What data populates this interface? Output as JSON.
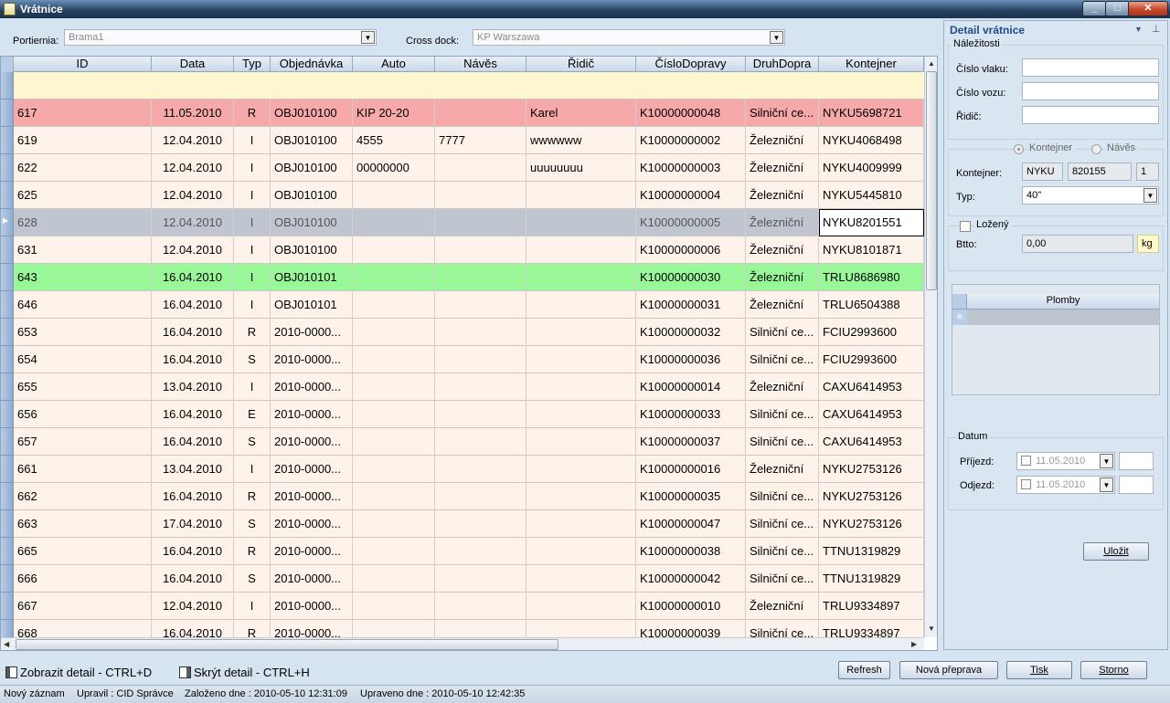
{
  "window": {
    "title": "Vrátnice",
    "minimize": "_",
    "maximize": "□",
    "close": "✕"
  },
  "filters": {
    "portiernia_label": "Portiernia:",
    "portiernia_value": "Brama1",
    "crossdock_label": "Cross dock:",
    "crossdock_value": "KP Warszawa"
  },
  "grid": {
    "columns": [
      "ID",
      "Data",
      "Typ",
      "Objednávka",
      "Auto",
      "Návěs",
      "Řidič",
      "ČísloDopravy",
      "DruhDopra",
      "Kontejner"
    ],
    "rows": [
      {
        "id": "617",
        "data": "11.05.2010",
        "typ": "R",
        "obj": "OBJ010100",
        "auto": "KIP 20-20",
        "naves": "",
        "ridic": "Karel",
        "cislo": "K10000000048",
        "druh": "Silniční ce...",
        "kont": "NYKU5698721",
        "bg": "#f7a9a9"
      },
      {
        "id": "619",
        "data": "12.04.2010",
        "typ": "I",
        "obj": "OBJ010100",
        "auto": "4555",
        "naves": "7777",
        "ridic": "wwwwww",
        "cislo": "K10000000002",
        "druh": "Železniční",
        "kont": "NYKU4068498",
        "bg": "#fdf3ea"
      },
      {
        "id": "622",
        "data": "12.04.2010",
        "typ": "I",
        "obj": "OBJ010100",
        "auto": "00000000",
        "naves": "",
        "ridic": "uuuuuuuu",
        "cislo": "K10000000003",
        "druh": "Železniční",
        "kont": "NYKU4009999",
        "bg": "#fdf3ea"
      },
      {
        "id": "625",
        "data": "12.04.2010",
        "typ": "I",
        "obj": "OBJ010100",
        "auto": "",
        "naves": "",
        "ridic": "",
        "cislo": "K10000000004",
        "druh": "Železniční",
        "kont": "NYKU5445810",
        "bg": "#fdf3ea"
      },
      {
        "id": "628",
        "data": "12.04.2010",
        "typ": "I",
        "obj": "OBJ010100",
        "auto": "",
        "naves": "",
        "ridic": "",
        "cislo": "K10000000005",
        "druh": "Železniční",
        "kont": "NYKU8201551",
        "bg": "#bfc6cf",
        "current": true
      },
      {
        "id": "631",
        "data": "12.04.2010",
        "typ": "I",
        "obj": "OBJ010100",
        "auto": "",
        "naves": "",
        "ridic": "",
        "cislo": "K10000000006",
        "druh": "Železniční",
        "kont": "NYKU8101871",
        "bg": "#fdf3ea"
      },
      {
        "id": "643",
        "data": "16.04.2010",
        "typ": "I",
        "obj": "OBJ010101",
        "auto": "",
        "naves": "",
        "ridic": "",
        "cislo": "K10000000030",
        "druh": "Železniční",
        "kont": "TRLU8686980",
        "bg": "#98f898"
      },
      {
        "id": "646",
        "data": "16.04.2010",
        "typ": "I",
        "obj": "OBJ010101",
        "auto": "",
        "naves": "",
        "ridic": "",
        "cislo": "K10000000031",
        "druh": "Železniční",
        "kont": "TRLU6504388",
        "bg": "#fdf3ea"
      },
      {
        "id": "653",
        "data": "16.04.2010",
        "typ": "R",
        "obj": "2010-0000...",
        "auto": "",
        "naves": "",
        "ridic": "",
        "cislo": "K10000000032",
        "druh": "Silniční ce...",
        "kont": "FCIU2993600",
        "bg": "#fdf3ea"
      },
      {
        "id": "654",
        "data": "16.04.2010",
        "typ": "S",
        "obj": "2010-0000...",
        "auto": "",
        "naves": "",
        "ridic": "",
        "cislo": "K10000000036",
        "druh": "Silniční ce...",
        "kont": "FCIU2993600",
        "bg": "#fdf3ea"
      },
      {
        "id": "655",
        "data": "13.04.2010",
        "typ": "I",
        "obj": "2010-0000...",
        "auto": "",
        "naves": "",
        "ridic": "",
        "cislo": "K10000000014",
        "druh": "Železniční",
        "kont": "CAXU6414953",
        "bg": "#fdf3ea"
      },
      {
        "id": "656",
        "data": "16.04.2010",
        "typ": "E",
        "obj": "2010-0000...",
        "auto": "",
        "naves": "",
        "ridic": "",
        "cislo": "K10000000033",
        "druh": "Silniční ce...",
        "kont": "CAXU6414953",
        "bg": "#fdf3ea"
      },
      {
        "id": "657",
        "data": "16.04.2010",
        "typ": "S",
        "obj": "2010-0000...",
        "auto": "",
        "naves": "",
        "ridic": "",
        "cislo": "K10000000037",
        "druh": "Silniční ce...",
        "kont": "CAXU6414953",
        "bg": "#fdf3ea"
      },
      {
        "id": "661",
        "data": "13.04.2010",
        "typ": "I",
        "obj": "2010-0000...",
        "auto": "",
        "naves": "",
        "ridic": "",
        "cislo": "K10000000016",
        "druh": "Železniční",
        "kont": "NYKU2753126",
        "bg": "#fdf3ea"
      },
      {
        "id": "662",
        "data": "16.04.2010",
        "typ": "R",
        "obj": "2010-0000...",
        "auto": "",
        "naves": "",
        "ridic": "",
        "cislo": "K10000000035",
        "druh": "Silniční ce...",
        "kont": "NYKU2753126",
        "bg": "#fdf3ea"
      },
      {
        "id": "663",
        "data": "17.04.2010",
        "typ": "S",
        "obj": "2010-0000...",
        "auto": "",
        "naves": "",
        "ridic": "",
        "cislo": "K10000000047",
        "druh": "Silniční ce...",
        "kont": "NYKU2753126",
        "bg": "#fdf3ea"
      },
      {
        "id": "665",
        "data": "16.04.2010",
        "typ": "R",
        "obj": "2010-0000...",
        "auto": "",
        "naves": "",
        "ridic": "",
        "cislo": "K10000000038",
        "druh": "Silniční ce...",
        "kont": "TTNU1319829",
        "bg": "#fdf3ea"
      },
      {
        "id": "666",
        "data": "16.04.2010",
        "typ": "S",
        "obj": "2010-0000...",
        "auto": "",
        "naves": "",
        "ridic": "",
        "cislo": "K10000000042",
        "druh": "Silniční ce...",
        "kont": "TTNU1319829",
        "bg": "#fdf3ea"
      },
      {
        "id": "667",
        "data": "12.04.2010",
        "typ": "I",
        "obj": "2010-0000...",
        "auto": "",
        "naves": "",
        "ridic": "",
        "cislo": "K10000000010",
        "druh": "Železniční",
        "kont": "TRLU9334897",
        "bg": "#fdf3ea"
      },
      {
        "id": "668",
        "data": "16.04.2010",
        "typ": "R",
        "obj": "2010-0000...",
        "auto": "",
        "naves": "",
        "ridic": "",
        "cislo": "K10000000039",
        "druh": "Silniční ce...",
        "kont": "TRLU9334897",
        "bg": "#fdf3ea"
      }
    ]
  },
  "detail": {
    "title": "Detail vrátnice",
    "naleznosti": "Náležitosti",
    "cislo_vlaku": "Číslo vlaku:",
    "cislo_vozu": "Číslo vozu:",
    "ridic": "Řidič:",
    "radio_kontejner": "Kontejner",
    "radio_naves": "Návěs",
    "kontejner_label": "Kontejner:",
    "kont_prefix": "NYKU",
    "kont_number": "820155",
    "kont_check": "1",
    "typ_label": "Typ:",
    "typ_value": "40\"",
    "lozeny": "Ložený",
    "btto_label": "Btto:",
    "btto_value": "0,00",
    "btto_unit": "kg",
    "plomby_header": "Plomby",
    "plomby_new": "✳",
    "datum": "Datum",
    "prijezd_label": "Příjezd:",
    "prijezd_value": "11.05.2010",
    "odjezd_label": "Odjezd:",
    "odjezd_value": "11.05.2010",
    "ulozit": "Uložit"
  },
  "bottom": {
    "zobrazit": "Zobrazit detail - CTRL+D",
    "skryt": "Skrýt detail - CTRL+H",
    "refresh": "Refresh",
    "nova": "Nová přeprava",
    "tisk": "Tisk",
    "storno": "Storno"
  },
  "status": {
    "zaznam": "Nový záznam",
    "upravil": "Upravil : CID Správce",
    "zalozeno": "Založeno dne : 2010-05-10 12:31:09",
    "upraveno": "Upraveno dne : 2010-05-10 12:42:35"
  }
}
